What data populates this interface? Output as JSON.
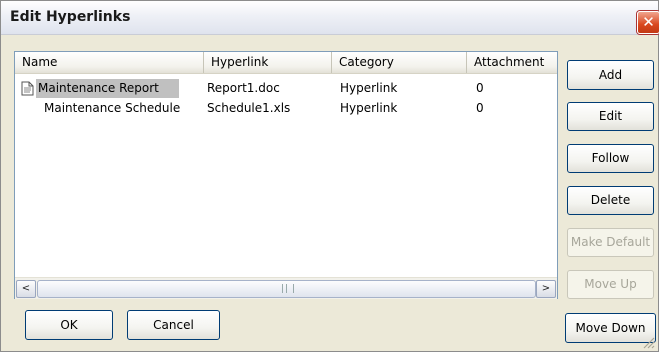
{
  "window": {
    "title": "Edit Hyperlinks",
    "close_glyph": "✕"
  },
  "list": {
    "columns": [
      "Name",
      "Hyperlink",
      "Category",
      "Attachment"
    ],
    "rows": [
      {
        "name": "Maintenance Report",
        "hyperlink": "Report1.doc",
        "category": "Hyperlink",
        "attachment": "0",
        "selected": true,
        "icon": "document-icon"
      },
      {
        "name": "Maintenance Schedule",
        "hyperlink": "Schedule1.xls",
        "category": "Hyperlink",
        "attachment": "0",
        "selected": false,
        "icon": ""
      }
    ]
  },
  "scrollbar": {
    "left_arrow": "<",
    "right_arrow": ">"
  },
  "side_buttons": {
    "add": "Add",
    "edit": "Edit",
    "follow": "Follow",
    "delete": "Delete",
    "make_default": "Make Default",
    "move_up": "Move Up",
    "move_down": "Move Down"
  },
  "footer_buttons": {
    "ok": "OK",
    "cancel": "Cancel"
  }
}
